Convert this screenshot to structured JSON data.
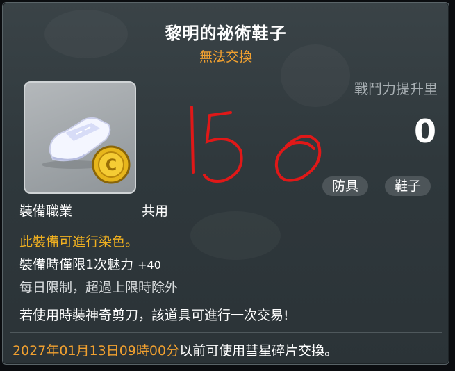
{
  "item": {
    "name": "黎明的祕術鞋子",
    "trade_status": "無法交換",
    "icon": "shoes-icon",
    "power_label": "戰鬥力提升里",
    "power_value": "0",
    "tags": [
      "防具",
      "鞋子"
    ],
    "job_label": "裝備職業",
    "job_value": "共用",
    "dye_text": "此裝備可進行染色。",
    "limit_text": "裝備時僅限1次魅力",
    "limit_bonus": "+40",
    "daily_text": "每日限制，超過上限時除外",
    "trade_text": "若使用時裝神奇剪刀，該道具可進行一次交易!",
    "expiry_date": "2027年01月13日09時00分",
    "expiry_suffix": "以前可使用彗星碎片交換。"
  },
  "colors": {
    "title": "#ffffff",
    "accent_orange": "#f0a030",
    "dye_yellow": "#f0b020",
    "scribble_red": "#e01818"
  }
}
